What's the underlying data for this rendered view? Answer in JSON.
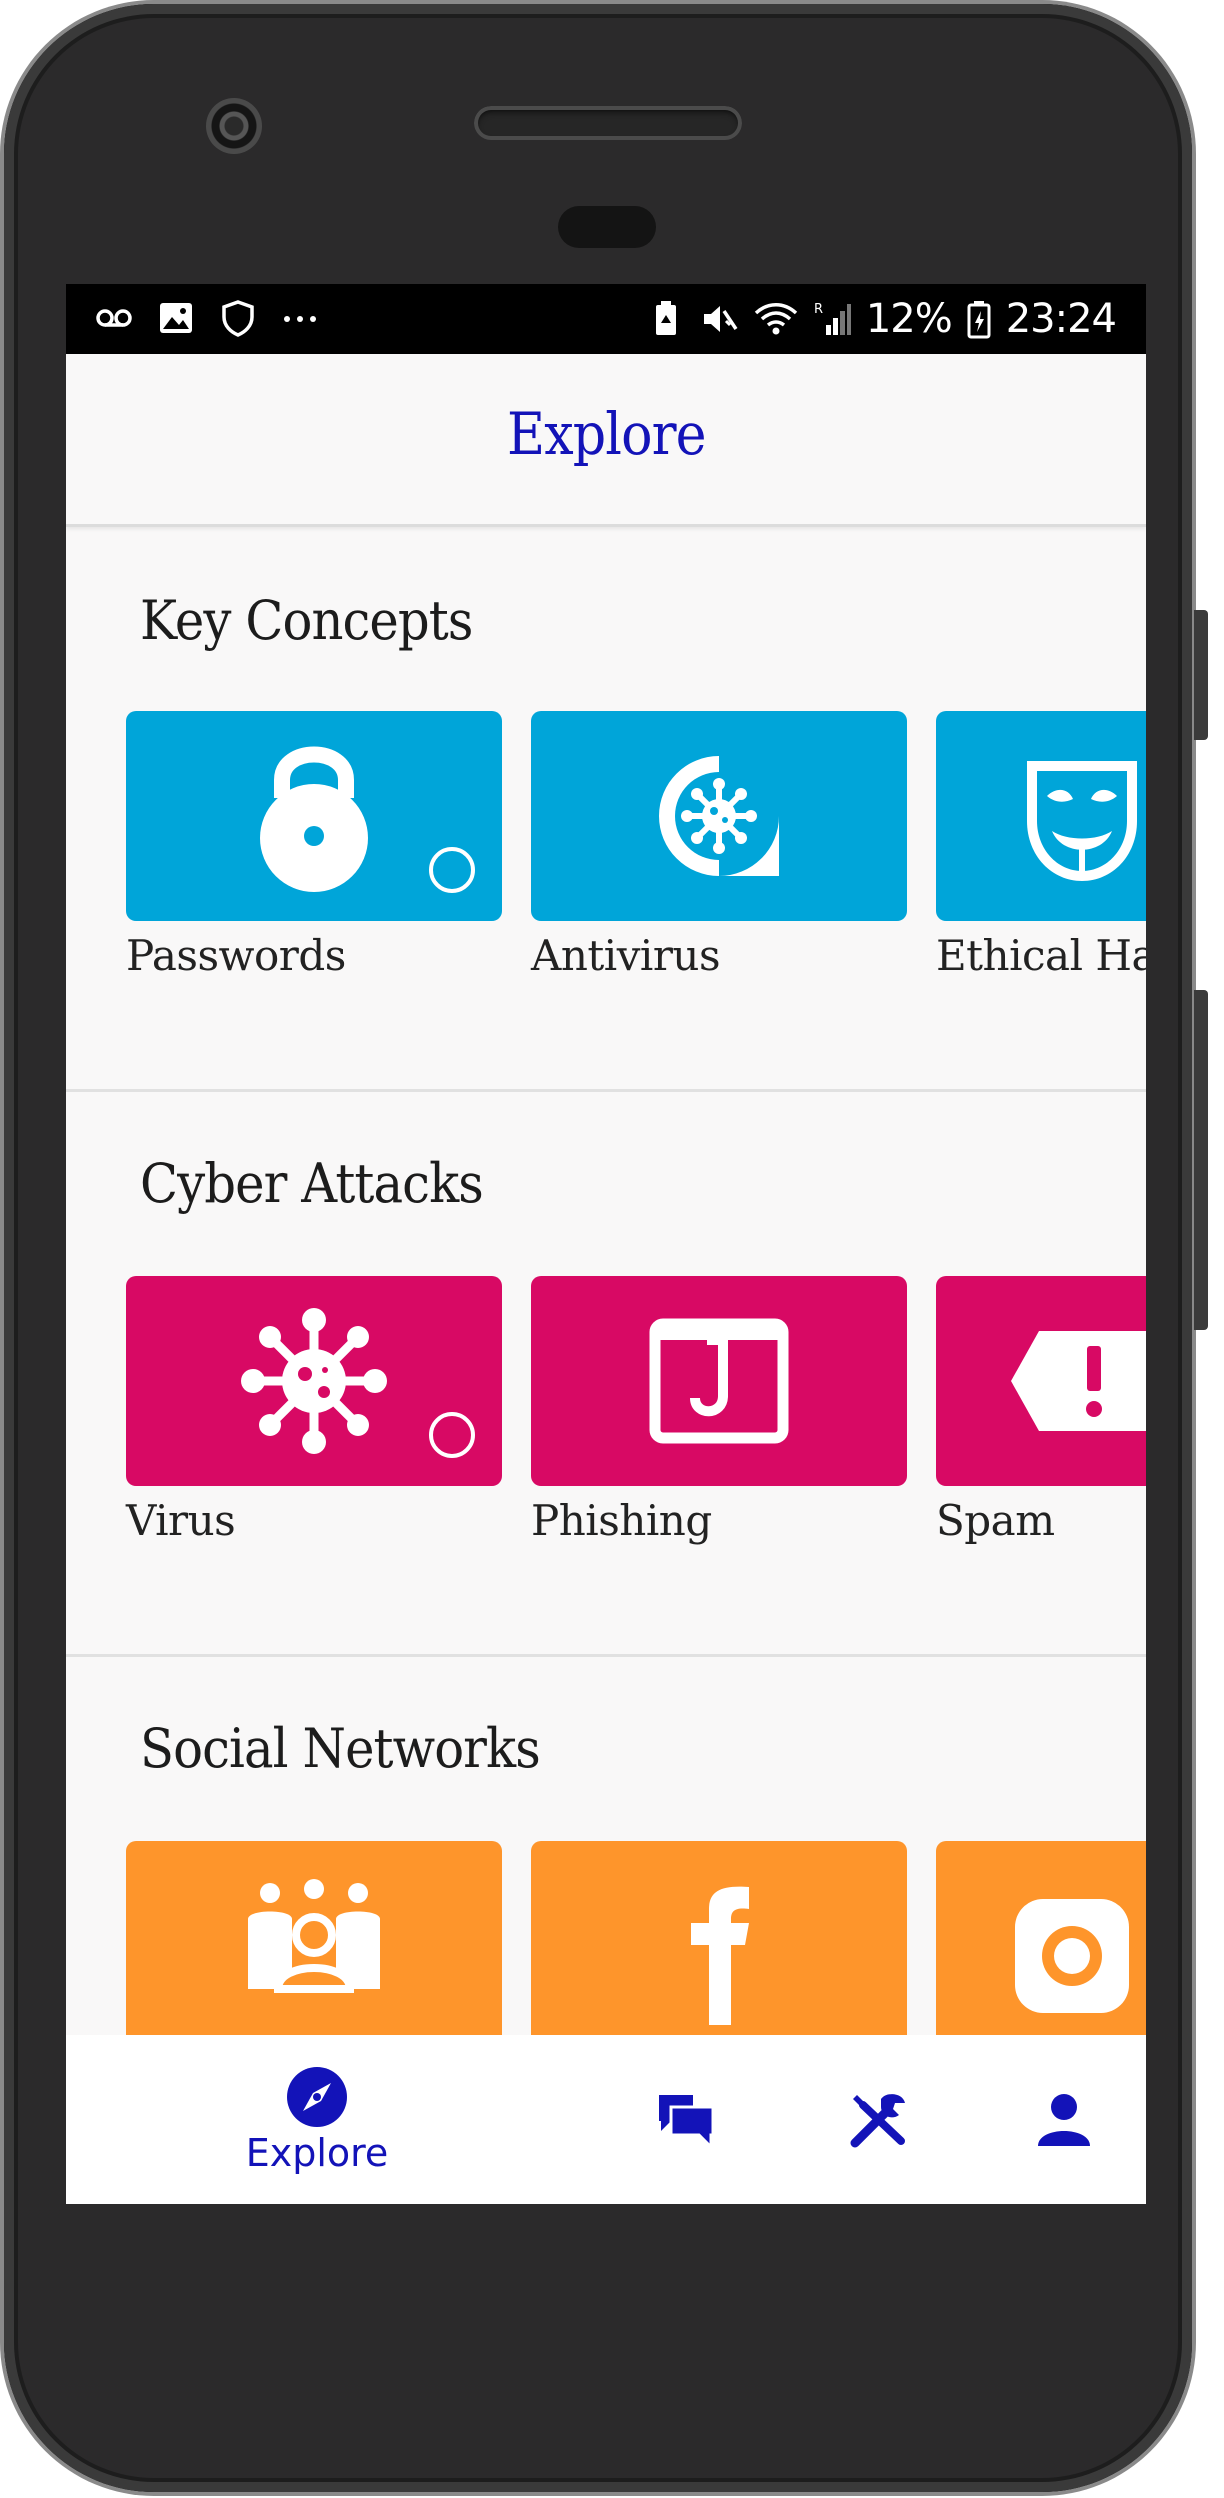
{
  "status_bar": {
    "battery_percent": "12%",
    "time": "23:24",
    "left_icons": [
      "voicemail-icon",
      "image-icon",
      "shield-icon",
      "more-dots-icon"
    ],
    "right_icons": [
      "battery-saver-icon",
      "mute-icon",
      "wifi-icon",
      "signal-icon",
      "battery-icon"
    ]
  },
  "header": {
    "title": "Explore"
  },
  "sections": [
    {
      "title": "Key Concepts",
      "color": "#00a5d9",
      "cards": [
        {
          "label": "Passwords",
          "icon": "padlock-icon"
        },
        {
          "label": "Antivirus",
          "icon": "antivirus-icon"
        },
        {
          "label": "Ethical Hacking",
          "icon": "hacker-mask-icon"
        }
      ]
    },
    {
      "title": "Cyber Attacks",
      "color": "#d80964",
      "cards": [
        {
          "label": "Virus",
          "icon": "virus-icon"
        },
        {
          "label": "Phishing",
          "icon": "phishing-hook-icon"
        },
        {
          "label": "Spam",
          "icon": "spam-tag-icon"
        }
      ]
    },
    {
      "title": "Social Networks",
      "color": "#fe952b",
      "cards": [
        {
          "label": "",
          "icon": "group-icon"
        },
        {
          "label": "",
          "icon": "facebook-icon"
        },
        {
          "label": "",
          "icon": "instagram-icon"
        }
      ]
    }
  ],
  "bottom_nav": {
    "accent": "#1313b8",
    "items": [
      {
        "label": "Explore",
        "icon": "compass-icon",
        "active": true
      },
      {
        "label": "",
        "icon": "chat-icon"
      },
      {
        "label": "",
        "icon": "tools-icon"
      },
      {
        "label": "",
        "icon": "profile-icon"
      }
    ]
  }
}
